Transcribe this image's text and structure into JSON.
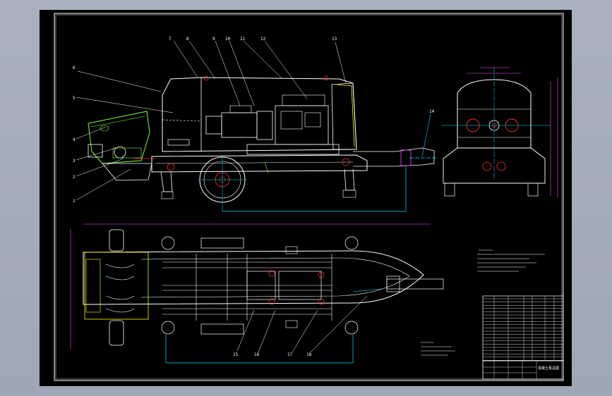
{
  "drawing": {
    "sheet_color": "#000000",
    "viewport_color": "#a9b1bf",
    "line_colors": {
      "outline": "#ffffff",
      "center_line": "#00e5ff",
      "dimension": "#ff4dff",
      "hidden": "#ffff00",
      "hopper": "#7cff3a",
      "marks": "#ff3030"
    }
  },
  "callouts": {
    "left": [
      "1",
      "2",
      "3",
      "4",
      "5",
      "6"
    ],
    "top": [
      "7",
      "8",
      "9",
      "10",
      "11",
      "12",
      "13"
    ],
    "right_top": "14",
    "bottom": [
      "15",
      "16",
      "17",
      "18"
    ]
  },
  "title_block": {
    "name_cell": "混凝土泵总图"
  }
}
